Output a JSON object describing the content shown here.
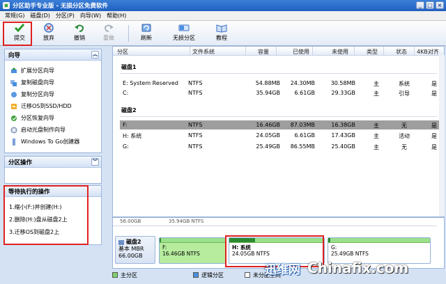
{
  "window": {
    "title": "分区助手专业版 - 无损分区免费软件"
  },
  "menu": [
    "常规(G)",
    "磁盘(D)",
    "分区(P)",
    "向导(W)",
    "帮助(H)"
  ],
  "toolbar": {
    "items": [
      {
        "label": "提交",
        "icon": "check-icon"
      },
      {
        "label": "放弃",
        "icon": "discard-icon"
      },
      {
        "label": "撤销",
        "icon": "undo-icon"
      },
      {
        "label": "重做",
        "icon": "redo-icon"
      },
      {
        "label": "刷新",
        "icon": "refresh-icon"
      },
      {
        "label": "无损分区",
        "icon": "partition-icon"
      },
      {
        "label": "教程",
        "icon": "tutorial-icon"
      }
    ]
  },
  "wizard": {
    "title": "向导",
    "items": [
      "扩展分区向导",
      "复制磁盘向导",
      "复制分区向导",
      "迁移OS到SSD/HDD",
      "分区恢复向导",
      "启动光盘制作向导",
      "Windows To Go创建器"
    ]
  },
  "partition_ops": {
    "title": "分区操作"
  },
  "pending": {
    "title": "等待执行的操作",
    "items": [
      "1.缩小(F:)并创建(H:)",
      "2.删除(H:)盘从磁盘2上",
      "3.迁移OS到磁盘2上"
    ]
  },
  "table": {
    "columns": [
      "分区",
      "文件系统",
      "容量",
      "已使用",
      "未使用",
      "类型",
      "状态",
      "4KB对齐"
    ],
    "disks": [
      {
        "name": "磁盘1",
        "rows": [
          {
            "partition": "E: System Reserved",
            "fs": "NTFS",
            "capacity": "54.88MB",
            "used": "24.30MB",
            "free": "30.58MB",
            "type": "主",
            "status": "系统",
            "align": "是"
          },
          {
            "partition": "C:",
            "fs": "NTFS",
            "capacity": "35.94GB",
            "used": "6.61GB",
            "free": "29.33GB",
            "type": "主",
            "status": "引导",
            "align": "是"
          }
        ]
      },
      {
        "name": "磁盘2",
        "rows": [
          {
            "partition": "F:",
            "fs": "NTFS",
            "capacity": "16.46GB",
            "used": "87.03MB",
            "free": "16.38GB",
            "type": "主",
            "status": "无",
            "align": "是"
          },
          {
            "partition": "H: 系统",
            "fs": "NTFS",
            "capacity": "24.05GB",
            "used": "6.61GB",
            "free": "17.43GB",
            "type": "主",
            "status": "活动",
            "align": "是"
          },
          {
            "partition": "G:",
            "fs": "NTFS",
            "capacity": "25.49GB",
            "used": "86.55MB",
            "free": "25.40GB",
            "type": "主",
            "status": "无",
            "align": "是"
          }
        ]
      }
    ]
  },
  "diskmap": {
    "prev_size": "56.00GB",
    "prev_detail": "35.94GB NTFS",
    "disk": {
      "name": "磁盘2",
      "type": "基本 MBR",
      "size": "66.00GB"
    },
    "parts": [
      {
        "label": "F:",
        "detail": "16.46GB NTFS",
        "used_fraction": 0.01
      },
      {
        "label": "H: 系统",
        "detail": "24.05GB NTFS",
        "used_fraction": 0.27
      },
      {
        "label": "G:",
        "detail": "25.49GB NTFS",
        "used_fraction": 0.01
      }
    ],
    "footnote": "未分配空间"
  },
  "legend": [
    {
      "label": "主分区",
      "color": "#7fd36a"
    },
    {
      "label": "逻辑分区",
      "color": "#4a8fe0"
    },
    {
      "label": "未分配空间",
      "color": "#ffffff"
    }
  ],
  "watermark": {
    "cn": "迅维网",
    "en": "Chinafix.com"
  }
}
